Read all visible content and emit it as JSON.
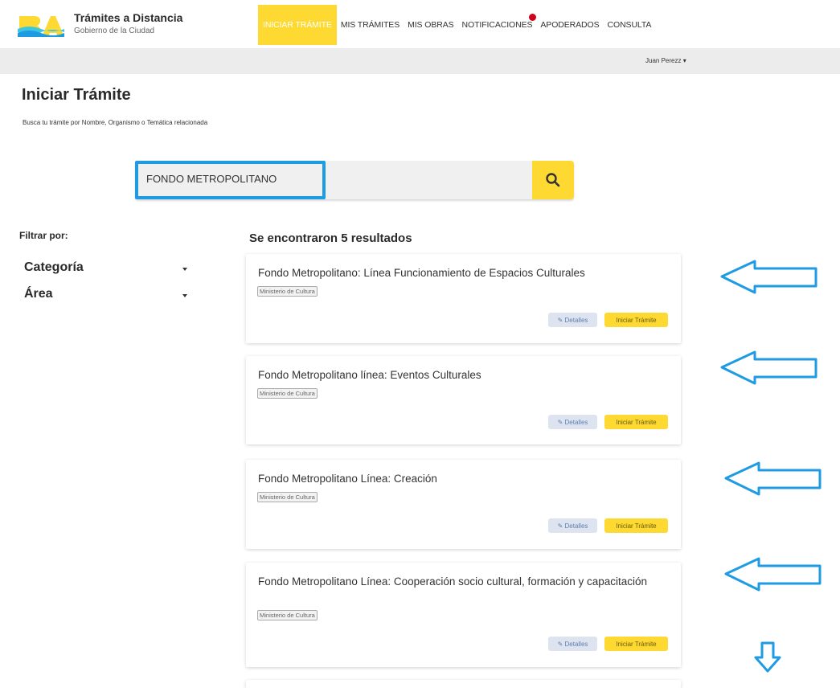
{
  "header": {
    "brand_title": "Trámites a Distancia",
    "brand_subtitle": "Gobierno de la Ciudad",
    "nav": [
      {
        "label": "INICIAR TRÁMITE"
      },
      {
        "label": "MIS TRÁMITES"
      },
      {
        "label": "MIS OBRAS"
      },
      {
        "label": "NOTIFICACIONES"
      },
      {
        "label": "APODERADOS"
      },
      {
        "label": "CONSULTA"
      }
    ],
    "user_name": "Juan Perezz ▾"
  },
  "page": {
    "title": "Iniciar Trámite",
    "subtitle": "Busca tu trámite por Nombre, Organismo o Temática relacionada"
  },
  "search": {
    "value": "FONDO METROPOLITANO"
  },
  "filters": {
    "title": "Filtrar por:",
    "items": [
      {
        "label": "Categoría"
      },
      {
        "label": "Área"
      }
    ]
  },
  "results": {
    "count_text": "Se encontraron 5 resultados",
    "items": [
      {
        "title": "Fondo Metropolitano: Línea Funcionamiento de Espacios Culturales",
        "tag": "Ministerio de Cultura",
        "details": "✎ Detalles",
        "start": "Iniciar Trámite"
      },
      {
        "title": "Fondo Metropolitano línea: Eventos Culturales",
        "tag": "Ministerio de Cultura",
        "details": "✎ Detalles",
        "start": "Iniciar Trámite"
      },
      {
        "title": "Fondo Metropolitano Línea: Creación",
        "tag": "Ministerio de Cultura",
        "details": "✎ Detalles",
        "start": "Iniciar Trámite"
      },
      {
        "title": "Fondo Metropolitano Línea: Cooperación socio cultural, formación y capacitación",
        "tag": "Ministerio de Cultura",
        "details": "✎ Detalles",
        "start": "Iniciar Trámite"
      }
    ]
  },
  "colors": {
    "accent_yellow": "#fdd931",
    "highlight_blue": "#1e9be3",
    "notification_red": "#d0021b"
  }
}
